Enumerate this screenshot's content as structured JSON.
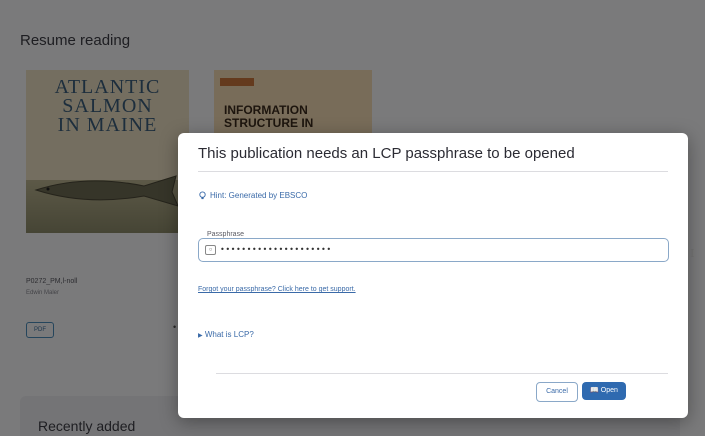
{
  "background": {
    "section_title": "Resume reading",
    "book1": {
      "cover_title": "ATLANTIC\nSALMON\nIN MAINE",
      "meta": "P0272_PM,l-noll",
      "author": "Edwin Maler",
      "badge": "PDF",
      "more": "•"
    },
    "book2": {
      "cover_tag": "",
      "cover_small": "",
      "cover_title": "INFORMATION\nSTRUCTURE IN"
    },
    "recent_title": "Recently added"
  },
  "dialog": {
    "title": "This publication needs an LCP passphrase to be opened",
    "hint": "Hint: Generated by EBSCO",
    "passphrase_label": "Passphrase",
    "passphrase_value": "•••••••••••••••••••••",
    "forgot_link": "Forgot your passphrase? Click here to get support.",
    "lcp_toggle": "What is LCP?",
    "cancel_label": "Cancel",
    "open_label": "Open"
  },
  "colors": {
    "accent": "#2f6ab0",
    "link": "#3a6aa8",
    "overlay": "rgba(0,0,0,0.5)"
  },
  "icons": {
    "hint": "lightbulb-icon",
    "passphrase_toggle": "eye-icon",
    "lcp_expand": "triangle-right-icon",
    "open": "book-icon",
    "cursor": "text-cursor-icon"
  }
}
